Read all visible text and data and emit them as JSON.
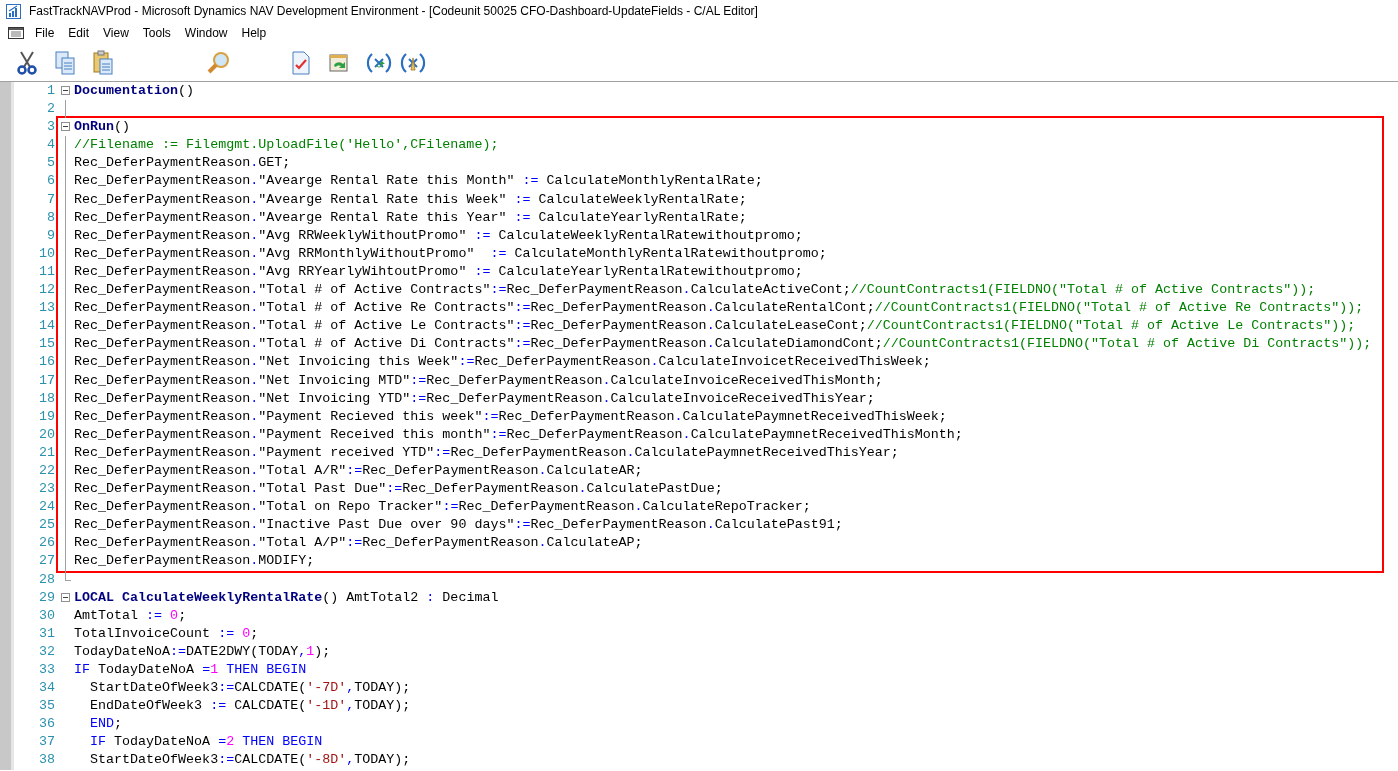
{
  "window": {
    "title": "FastTrackNAVProd - Microsoft Dynamics NAV Development Environment - [Codeunit 50025 CFO-Dashboard-UpdateFields - C/AL Editor]"
  },
  "menu": [
    "File",
    "Edit",
    "View",
    "Tools",
    "Window",
    "Help"
  ],
  "editor": {
    "sections": [
      {
        "highlighted": false,
        "lines": [
          {
            "number": "1",
            "kind": "trigger",
            "expanded": true,
            "segments": [
              {
                "kind": "kw",
                "text": "Documentation"
              },
              {
                "kind": "plain",
                "text": "()"
              }
            ]
          },
          {
            "number": "2",
            "kind": "inner"
          }
        ]
      },
      {
        "highlighted": true,
        "lines": [
          {
            "number": "3",
            "kind": "trigger",
            "expanded": true,
            "segments": [
              {
                "kind": "kw",
                "text": "OnRun"
              },
              {
                "kind": "plain",
                "text": "()"
              }
            ]
          },
          {
            "number": "4",
            "kind": "inner",
            "segments": [
              {
                "kind": "comment",
                "text": "//Filename := Filemgmt.UploadFile('Hello',CFilename);"
              }
            ]
          },
          {
            "number": "5",
            "kind": "inner",
            "segments": [
              {
                "kind": "plain",
                "text": "Rec_DeferPaymentReason"
              },
              {
                "kind": "op",
                "text": "."
              },
              {
                "kind": "plain",
                "text": "GET;"
              }
            ]
          },
          {
            "number": "6",
            "kind": "inner",
            "segments": [
              {
                "kind": "plain",
                "text": "Rec_DeferPaymentReason"
              },
              {
                "kind": "op",
                "text": "."
              },
              {
                "kind": "plain",
                "text": "\"Avearge Rental Rate this Month\" "
              },
              {
                "kind": "op",
                "text": ":="
              },
              {
                "kind": "plain",
                "text": " CalculateMonthlyRentalRate;"
              }
            ]
          },
          {
            "number": "7",
            "kind": "inner",
            "segments": [
              {
                "kind": "plain",
                "text": "Rec_DeferPaymentReason"
              },
              {
                "kind": "op",
                "text": "."
              },
              {
                "kind": "plain",
                "text": "\"Avearge Rental Rate this Week\" "
              },
              {
                "kind": "op",
                "text": ":="
              },
              {
                "kind": "plain",
                "text": " CalculateWeeklyRentalRate;"
              }
            ]
          },
          {
            "number": "8",
            "kind": "inner",
            "segments": [
              {
                "kind": "plain",
                "text": "Rec_DeferPaymentReason"
              },
              {
                "kind": "op",
                "text": "."
              },
              {
                "kind": "plain",
                "text": "\"Avearge Rental Rate this Year\" "
              },
              {
                "kind": "op",
                "text": ":="
              },
              {
                "kind": "plain",
                "text": " CalculateYearlyRentalRate;"
              }
            ]
          },
          {
            "number": "9",
            "kind": "inner",
            "segments": [
              {
                "kind": "plain",
                "text": "Rec_DeferPaymentReason"
              },
              {
                "kind": "op",
                "text": "."
              },
              {
                "kind": "plain",
                "text": "\"Avg RRWeeklyWithoutPromo\" "
              },
              {
                "kind": "op",
                "text": ":="
              },
              {
                "kind": "plain",
                "text": " CalculateWeeklyRentalRatewithoutpromo;"
              }
            ]
          },
          {
            "number": "10",
            "kind": "inner",
            "segments": [
              {
                "kind": "plain",
                "text": "Rec_DeferPaymentReason"
              },
              {
                "kind": "op",
                "text": "."
              },
              {
                "kind": "plain",
                "text": "\"Avg RRMonthlyWithoutPromo\"  "
              },
              {
                "kind": "op",
                "text": ":="
              },
              {
                "kind": "plain",
                "text": " CalculateMonthlyRentalRatewithoutpromo;"
              }
            ]
          },
          {
            "number": "11",
            "kind": "inner",
            "segments": [
              {
                "kind": "plain",
                "text": "Rec_DeferPaymentReason"
              },
              {
                "kind": "op",
                "text": "."
              },
              {
                "kind": "plain",
                "text": "\"Avg RRYearlyWihtoutPromo\" "
              },
              {
                "kind": "op",
                "text": ":="
              },
              {
                "kind": "plain",
                "text": " CalculateYearlyRentalRatewithoutpromo;"
              }
            ]
          },
          {
            "number": "12",
            "kind": "inner",
            "segments": [
              {
                "kind": "plain",
                "text": "Rec_DeferPaymentReason"
              },
              {
                "kind": "op",
                "text": "."
              },
              {
                "kind": "plain",
                "text": "\"Total # of Active Contracts\""
              },
              {
                "kind": "op",
                "text": ":="
              },
              {
                "kind": "plain",
                "text": "Rec_DeferPaymentReason"
              },
              {
                "kind": "op",
                "text": "."
              },
              {
                "kind": "plain",
                "text": "CalculateActiveCont;"
              },
              {
                "kind": "comment",
                "text": "//CountContracts1(FIELDNO(\"Total # of Active Contracts\"));"
              }
            ]
          },
          {
            "number": "13",
            "kind": "inner",
            "segments": [
              {
                "kind": "plain",
                "text": "Rec_DeferPaymentReason"
              },
              {
                "kind": "op",
                "text": "."
              },
              {
                "kind": "plain",
                "text": "\"Total # of Active Re Contracts\""
              },
              {
                "kind": "op",
                "text": ":="
              },
              {
                "kind": "plain",
                "text": "Rec_DeferPaymentReason"
              },
              {
                "kind": "op",
                "text": "."
              },
              {
                "kind": "plain",
                "text": "CalculateRentalCont;"
              },
              {
                "kind": "comment",
                "text": "//CountContracts1(FIELDNO(\"Total # of Active Re Contracts\"));"
              }
            ]
          },
          {
            "number": "14",
            "kind": "inner",
            "segments": [
              {
                "kind": "plain",
                "text": "Rec_DeferPaymentReason"
              },
              {
                "kind": "op",
                "text": "."
              },
              {
                "kind": "plain",
                "text": "\"Total # of Active Le Contracts\""
              },
              {
                "kind": "op",
                "text": ":="
              },
              {
                "kind": "plain",
                "text": "Rec_DeferPaymentReason"
              },
              {
                "kind": "op",
                "text": "."
              },
              {
                "kind": "plain",
                "text": "CalculateLeaseCont;"
              },
              {
                "kind": "comment",
                "text": "//CountContracts1(FIELDNO(\"Total # of Active Le Contracts\"));"
              }
            ]
          },
          {
            "number": "15",
            "kind": "inner",
            "segments": [
              {
                "kind": "plain",
                "text": "Rec_DeferPaymentReason"
              },
              {
                "kind": "op",
                "text": "."
              },
              {
                "kind": "plain",
                "text": "\"Total # of Active Di Contracts\""
              },
              {
                "kind": "op",
                "text": ":="
              },
              {
                "kind": "plain",
                "text": "Rec_DeferPaymentReason"
              },
              {
                "kind": "op",
                "text": "."
              },
              {
                "kind": "plain",
                "text": "CalculateDiamondCont;"
              },
              {
                "kind": "comment",
                "text": "//CountContracts1(FIELDNO(\"Total # of Active Di Contracts\"));"
              }
            ]
          },
          {
            "number": "16",
            "kind": "inner",
            "segments": [
              {
                "kind": "plain",
                "text": "Rec_DeferPaymentReason"
              },
              {
                "kind": "op",
                "text": "."
              },
              {
                "kind": "plain",
                "text": "\"Net Invoicing this Week\""
              },
              {
                "kind": "op",
                "text": ":="
              },
              {
                "kind": "plain",
                "text": "Rec_DeferPaymentReason"
              },
              {
                "kind": "op",
                "text": "."
              },
              {
                "kind": "plain",
                "text": "CalculateInvoicetReceivedThisWeek;"
              }
            ]
          },
          {
            "number": "17",
            "kind": "inner",
            "segments": [
              {
                "kind": "plain",
                "text": "Rec_DeferPaymentReason"
              },
              {
                "kind": "op",
                "text": "."
              },
              {
                "kind": "plain",
                "text": "\"Net Invoicing MTD\""
              },
              {
                "kind": "op",
                "text": ":="
              },
              {
                "kind": "plain",
                "text": "Rec_DeferPaymentReason"
              },
              {
                "kind": "op",
                "text": "."
              },
              {
                "kind": "plain",
                "text": "CalculateInvoiceReceivedThisMonth;"
              }
            ]
          },
          {
            "number": "18",
            "kind": "inner",
            "segments": [
              {
                "kind": "plain",
                "text": "Rec_DeferPaymentReason"
              },
              {
                "kind": "op",
                "text": "."
              },
              {
                "kind": "plain",
                "text": "\"Net Invoicing YTD\""
              },
              {
                "kind": "op",
                "text": ":="
              },
              {
                "kind": "plain",
                "text": "Rec_DeferPaymentReason"
              },
              {
                "kind": "op",
                "text": "."
              },
              {
                "kind": "plain",
                "text": "CalculateInvoiceReceivedThisYear;"
              }
            ]
          },
          {
            "number": "19",
            "kind": "inner",
            "segments": [
              {
                "kind": "plain",
                "text": "Rec_DeferPaymentReason"
              },
              {
                "kind": "op",
                "text": "."
              },
              {
                "kind": "plain",
                "text": "\"Payment Recieved this week\""
              },
              {
                "kind": "op",
                "text": ":="
              },
              {
                "kind": "plain",
                "text": "Rec_DeferPaymentReason"
              },
              {
                "kind": "op",
                "text": "."
              },
              {
                "kind": "plain",
                "text": "CalculatePaymnetReceivedThisWeek;"
              }
            ]
          },
          {
            "number": "20",
            "kind": "inner",
            "segments": [
              {
                "kind": "plain",
                "text": "Rec_DeferPaymentReason"
              },
              {
                "kind": "op",
                "text": "."
              },
              {
                "kind": "plain",
                "text": "\"Payment Received this month\""
              },
              {
                "kind": "op",
                "text": ":="
              },
              {
                "kind": "plain",
                "text": "Rec_DeferPaymentReason"
              },
              {
                "kind": "op",
                "text": "."
              },
              {
                "kind": "plain",
                "text": "CalculatePaymnetReceivedThisMonth;"
              }
            ]
          },
          {
            "number": "21",
            "kind": "inner",
            "segments": [
              {
                "kind": "plain",
                "text": "Rec_DeferPaymentReason"
              },
              {
                "kind": "op",
                "text": "."
              },
              {
                "kind": "plain",
                "text": "\"Payment received YTD\""
              },
              {
                "kind": "op",
                "text": ":="
              },
              {
                "kind": "plain",
                "text": "Rec_DeferPaymentReason"
              },
              {
                "kind": "op",
                "text": "."
              },
              {
                "kind": "plain",
                "text": "CalculatePaymnetReceivedThisYear;"
              }
            ]
          },
          {
            "number": "22",
            "kind": "inner",
            "segments": [
              {
                "kind": "plain",
                "text": "Rec_DeferPaymentReason"
              },
              {
                "kind": "op",
                "text": "."
              },
              {
                "kind": "plain",
                "text": "\"Total A/R\""
              },
              {
                "kind": "op",
                "text": ":="
              },
              {
                "kind": "plain",
                "text": "Rec_DeferPaymentReason"
              },
              {
                "kind": "op",
                "text": "."
              },
              {
                "kind": "plain",
                "text": "CalculateAR;"
              }
            ]
          },
          {
            "number": "23",
            "kind": "inner",
            "segments": [
              {
                "kind": "plain",
                "text": "Rec_DeferPaymentReason"
              },
              {
                "kind": "op",
                "text": "."
              },
              {
                "kind": "plain",
                "text": "\"Total Past Due\""
              },
              {
                "kind": "op",
                "text": ":="
              },
              {
                "kind": "plain",
                "text": "Rec_DeferPaymentReason"
              },
              {
                "kind": "op",
                "text": "."
              },
              {
                "kind": "plain",
                "text": "CalculatePastDue;"
              }
            ]
          },
          {
            "number": "24",
            "kind": "inner",
            "segments": [
              {
                "kind": "plain",
                "text": "Rec_DeferPaymentReason"
              },
              {
                "kind": "op",
                "text": "."
              },
              {
                "kind": "plain",
                "text": "\"Total on Repo Tracker\""
              },
              {
                "kind": "op",
                "text": ":="
              },
              {
                "kind": "plain",
                "text": "Rec_DeferPaymentReason"
              },
              {
                "kind": "op",
                "text": "."
              },
              {
                "kind": "plain",
                "text": "CalculateRepoTracker;"
              }
            ]
          },
          {
            "number": "25",
            "kind": "inner",
            "segments": [
              {
                "kind": "plain",
                "text": "Rec_DeferPaymentReason"
              },
              {
                "kind": "op",
                "text": "."
              },
              {
                "kind": "plain",
                "text": "\"Inactive Past Due over 90 days\""
              },
              {
                "kind": "op",
                "text": ":="
              },
              {
                "kind": "plain",
                "text": "Rec_DeferPaymentReason"
              },
              {
                "kind": "op",
                "text": "."
              },
              {
                "kind": "plain",
                "text": "CalculatePast91;"
              }
            ]
          },
          {
            "number": "26",
            "kind": "inner",
            "segments": [
              {
                "kind": "plain",
                "text": "Rec_DeferPaymentReason"
              },
              {
                "kind": "op",
                "text": "."
              },
              {
                "kind": "plain",
                "text": "\"Total A/P\""
              },
              {
                "kind": "op",
                "text": ":="
              },
              {
                "kind": "plain",
                "text": "Rec_DeferPaymentReason"
              },
              {
                "kind": "op",
                "text": "."
              },
              {
                "kind": "plain",
                "text": "CalculateAP;"
              }
            ]
          },
          {
            "number": "27",
            "kind": "inner",
            "segments": [
              {
                "kind": "plain",
                "text": "Rec_DeferPaymentReason"
              },
              {
                "kind": "op",
                "text": "."
              },
              {
                "kind": "plain",
                "text": "MODIFY;"
              }
            ]
          }
        ]
      },
      {
        "highlighted": false,
        "lines": [
          {
            "number": "28",
            "kind": "last"
          },
          {
            "number": "29",
            "kind": "trigger",
            "expanded": true,
            "segments": [
              {
                "kind": "kw",
                "text": "LOCAL CalculateWeeklyRentalRate"
              },
              {
                "kind": "plain",
                "text": "() AmtTotal2 "
              },
              {
                "kind": "op",
                "text": ":"
              },
              {
                "kind": "plain",
                "text": " Decimal"
              }
            ]
          },
          {
            "number": "30",
            "kind": "plain",
            "segments": [
              {
                "kind": "plain",
                "text": "AmtTotal "
              },
              {
                "kind": "op",
                "text": ":= "
              },
              {
                "kind": "num",
                "text": "0"
              },
              {
                "kind": "plain",
                "text": ";"
              }
            ]
          },
          {
            "number": "31",
            "kind": "plain",
            "segments": [
              {
                "kind": "plain",
                "text": "TotalInvoiceCount "
              },
              {
                "kind": "op",
                "text": ":= "
              },
              {
                "kind": "num",
                "text": "0"
              },
              {
                "kind": "plain",
                "text": ";"
              }
            ]
          },
          {
            "number": "32",
            "kind": "plain",
            "segments": [
              {
                "kind": "plain",
                "text": "TodayDateNoA"
              },
              {
                "kind": "op",
                "text": ":="
              },
              {
                "kind": "plain",
                "text": "DATE2DWY(TODAY"
              },
              {
                "kind": "op",
                "text": ","
              },
              {
                "kind": "num",
                "text": "1"
              },
              {
                "kind": "plain",
                "text": ");"
              }
            ]
          },
          {
            "number": "33",
            "kind": "plain",
            "segments": [
              {
                "kind": "ctl",
                "text": "IF"
              },
              {
                "kind": "plain",
                "text": " TodayDateNoA "
              },
              {
                "kind": "op",
                "text": "="
              },
              {
                "kind": "num",
                "text": "1"
              },
              {
                "kind": "ctl",
                "text": " THEN BEGIN"
              }
            ]
          },
          {
            "number": "34",
            "kind": "plain",
            "segments": [
              {
                "kind": "plain",
                "text": "  StartDateOfWeek3"
              },
              {
                "kind": "op",
                "text": ":="
              },
              {
                "kind": "plain",
                "text": "CALCDATE("
              },
              {
                "kind": "str",
                "text": "'-7D'"
              },
              {
                "kind": "op",
                "text": ","
              },
              {
                "kind": "plain",
                "text": "TODAY);"
              }
            ]
          },
          {
            "number": "35",
            "kind": "plain",
            "segments": [
              {
                "kind": "plain",
                "text": "  EndDateOfWeek3 "
              },
              {
                "kind": "op",
                "text": ":="
              },
              {
                "kind": "plain",
                "text": " CALCDATE("
              },
              {
                "kind": "str",
                "text": "'-1D'"
              },
              {
                "kind": "op",
                "text": ","
              },
              {
                "kind": "plain",
                "text": "TODAY);"
              }
            ]
          },
          {
            "number": "36",
            "kind": "plain",
            "segments": [
              {
                "kind": "ctl",
                "text": "  END"
              },
              {
                "kind": "plain",
                "text": ";"
              }
            ]
          },
          {
            "number": "37",
            "kind": "plain",
            "segments": [
              {
                "kind": "ctl",
                "text": "  IF"
              },
              {
                "kind": "plain",
                "text": " TodayDateNoA "
              },
              {
                "kind": "op",
                "text": "="
              },
              {
                "kind": "num",
                "text": "2"
              },
              {
                "kind": "ctl",
                "text": " THEN BEGIN"
              }
            ]
          },
          {
            "number": "38",
            "kind": "plain",
            "segments": [
              {
                "kind": "plain",
                "text": "  StartDateOfWeek3"
              },
              {
                "kind": "op",
                "text": ":="
              },
              {
                "kind": "plain",
                "text": "CALCDATE("
              },
              {
                "kind": "str",
                "text": "'-8D'"
              },
              {
                "kind": "op",
                "text": ","
              },
              {
                "kind": "plain",
                "text": "TODAY);"
              }
            ]
          }
        ]
      }
    ]
  }
}
